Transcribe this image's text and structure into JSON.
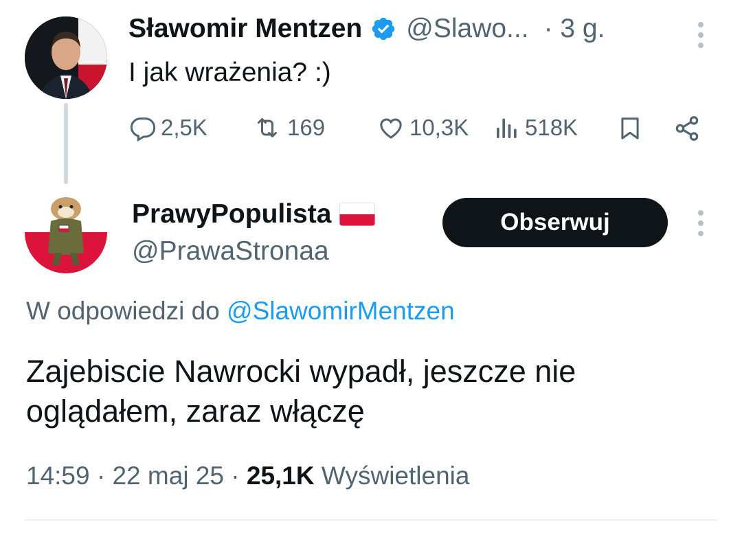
{
  "parent_tweet": {
    "author_name": "Sławomir Mentzen",
    "handle": "@Slawo...",
    "time": "· 3 g.",
    "text": "I jak wrażenia? :)",
    "actions": {
      "replies": "2,5K",
      "retweets": "169",
      "likes": "10,3K",
      "views": "518K"
    }
  },
  "reply_tweet": {
    "author_name": "PrawyPopulista",
    "handle": "@PrawaStronaa",
    "follow_label": "Obserwuj",
    "reply_context_prefix": "W odpowiedzi do",
    "reply_context_handle": "@SlawomirMentzen",
    "text": "Zajebiscie Nawrocki wypadł, jeszcze nie oglądałem, zaraz włączę",
    "time": "14:59",
    "date": "22 maj 25",
    "views_count": "25,1K",
    "views_label": "Wyświetlenia"
  },
  "colors": {
    "accent": "#1d9bf0",
    "muted": "#536471",
    "button_bg": "#0f1419",
    "flag_red": "#dc143c"
  }
}
